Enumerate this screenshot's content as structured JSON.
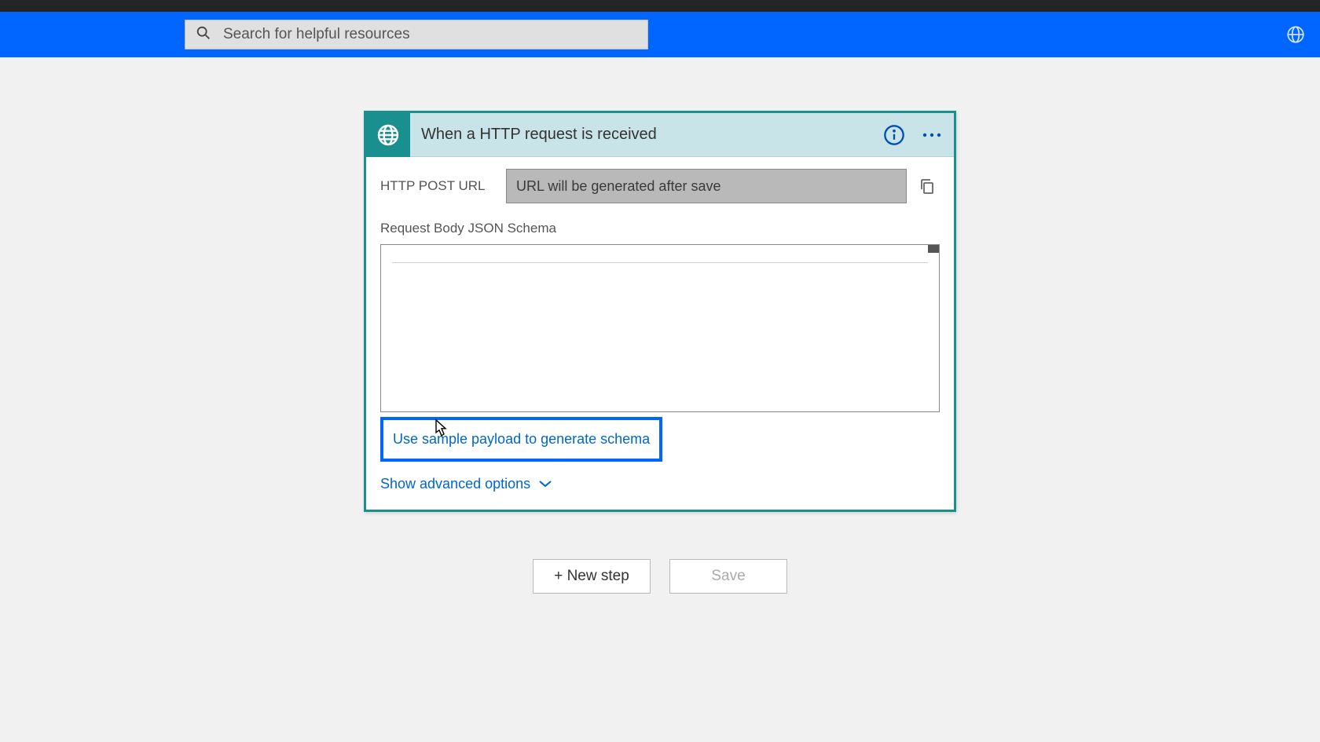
{
  "header": {
    "search_placeholder": "Search for helpful resources"
  },
  "card": {
    "title": "When a HTTP request is received",
    "url_label": "HTTP POST URL",
    "url_value": "URL will be generated after save",
    "schema_label": "Request Body JSON Schema",
    "sample_link": "Use sample payload to generate schema",
    "advanced_label": "Show advanced options"
  },
  "actions": {
    "new_step": "+ New step",
    "save": "Save"
  }
}
